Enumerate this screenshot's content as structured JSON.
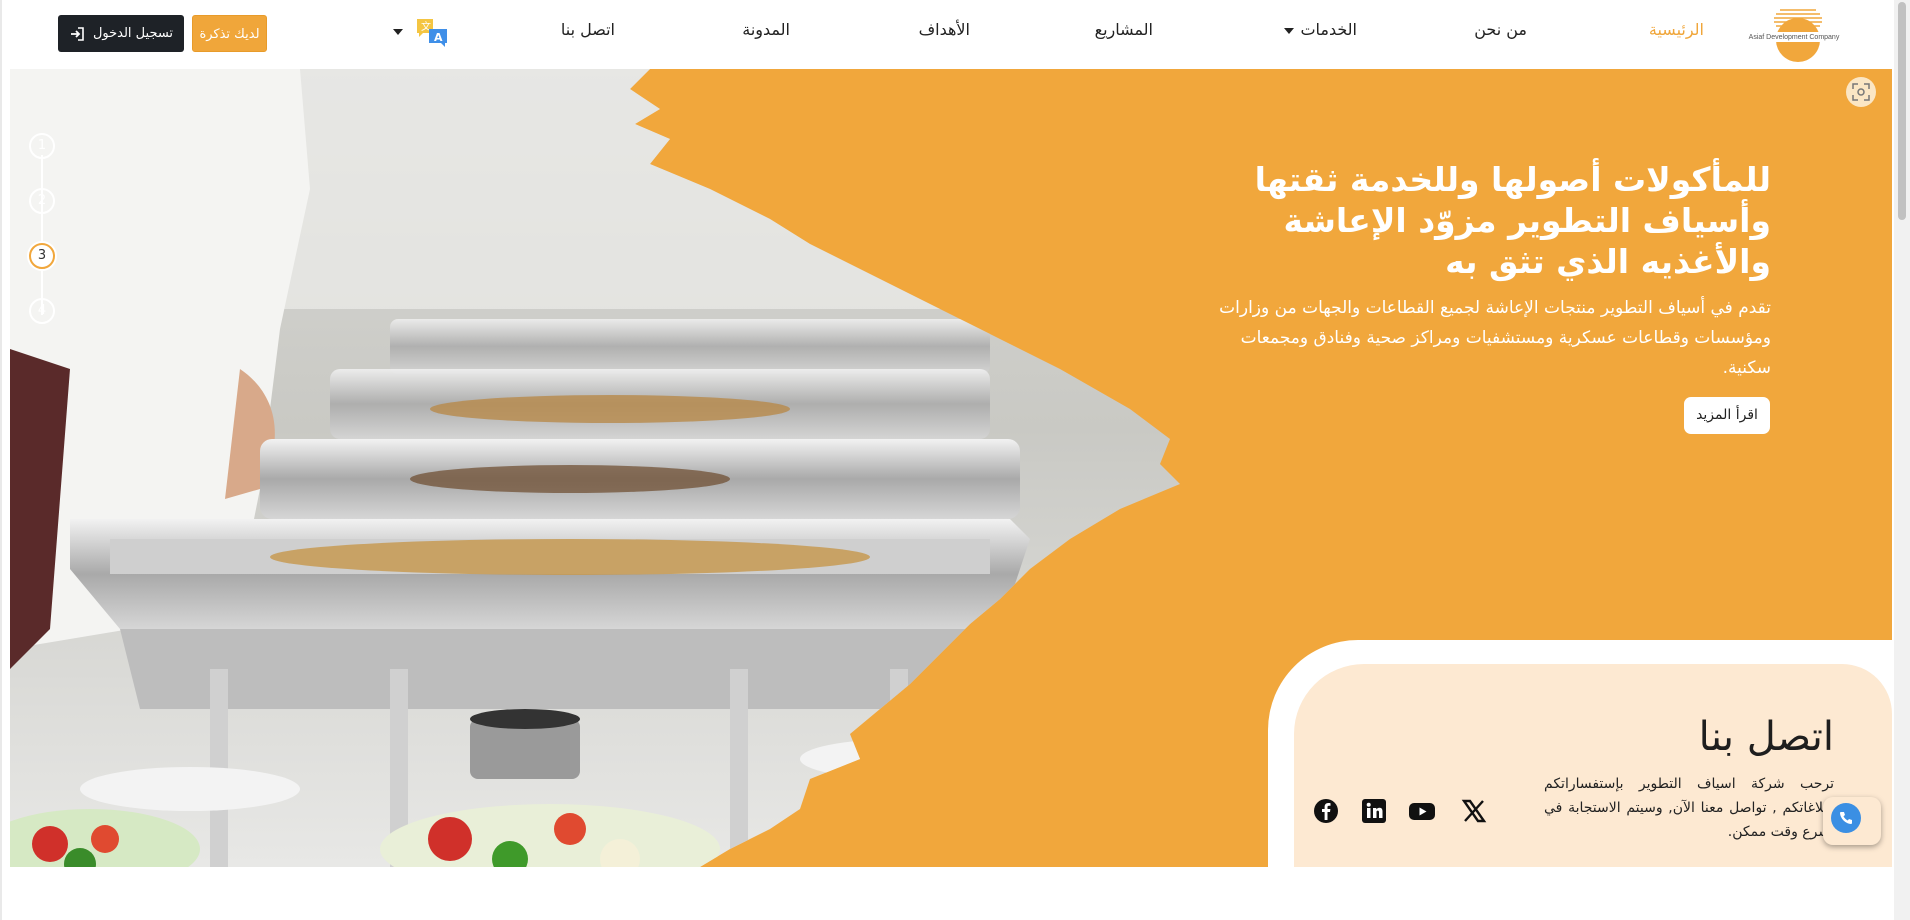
{
  "header": {
    "logo_text": "Asiaf Development Company",
    "nav": [
      {
        "label": "الرئيسية",
        "active": true
      },
      {
        "label": "من نحن",
        "active": false
      },
      {
        "label": "الخدمات",
        "active": false,
        "dropdown": true
      },
      {
        "label": "المشاريع",
        "active": false
      },
      {
        "label": "الأهداف",
        "active": false
      },
      {
        "label": "المدونة",
        "active": false
      },
      {
        "label": "اتصل بنا",
        "active": false
      }
    ],
    "language_icon": "translate-icon",
    "ticket_button": "لديك تذكرة",
    "login_button": "تسجيل الدخول",
    "login_icon": "login-icon"
  },
  "hero": {
    "title": "للمأكولات أصولها وللخدمة ثقتها وأسياف التطوير مزوّد الإعاشة والأغذيه الذي تثق به",
    "description": "تقدم في أسياف التطوير منتجات الإعاشة لجميع القطاعات والجهات من وزارات ومؤسسات وقطاعات عسكرية ومستشفيات ومراكز صحية وفنادق ومجمعات سكنية.",
    "read_more": "اقرأ المزيد",
    "steps": [
      "1",
      "2",
      "3",
      "4"
    ],
    "active_step": 3
  },
  "contact": {
    "title": "اتصل بنا",
    "text": "ترحب شركة اسياف التطوير بإستفساراتكم وبلاغاتكم , تواصل معنا الآن, وسيتم الاستجابة في أسرع وقت ممكن.",
    "socials": [
      "x-icon",
      "youtube-icon",
      "linkedin-icon",
      "facebook-icon"
    ]
  },
  "colors": {
    "accent": "#f1a73c",
    "dark_button": "#1e2227",
    "contact_bg": "#fde9d2"
  }
}
